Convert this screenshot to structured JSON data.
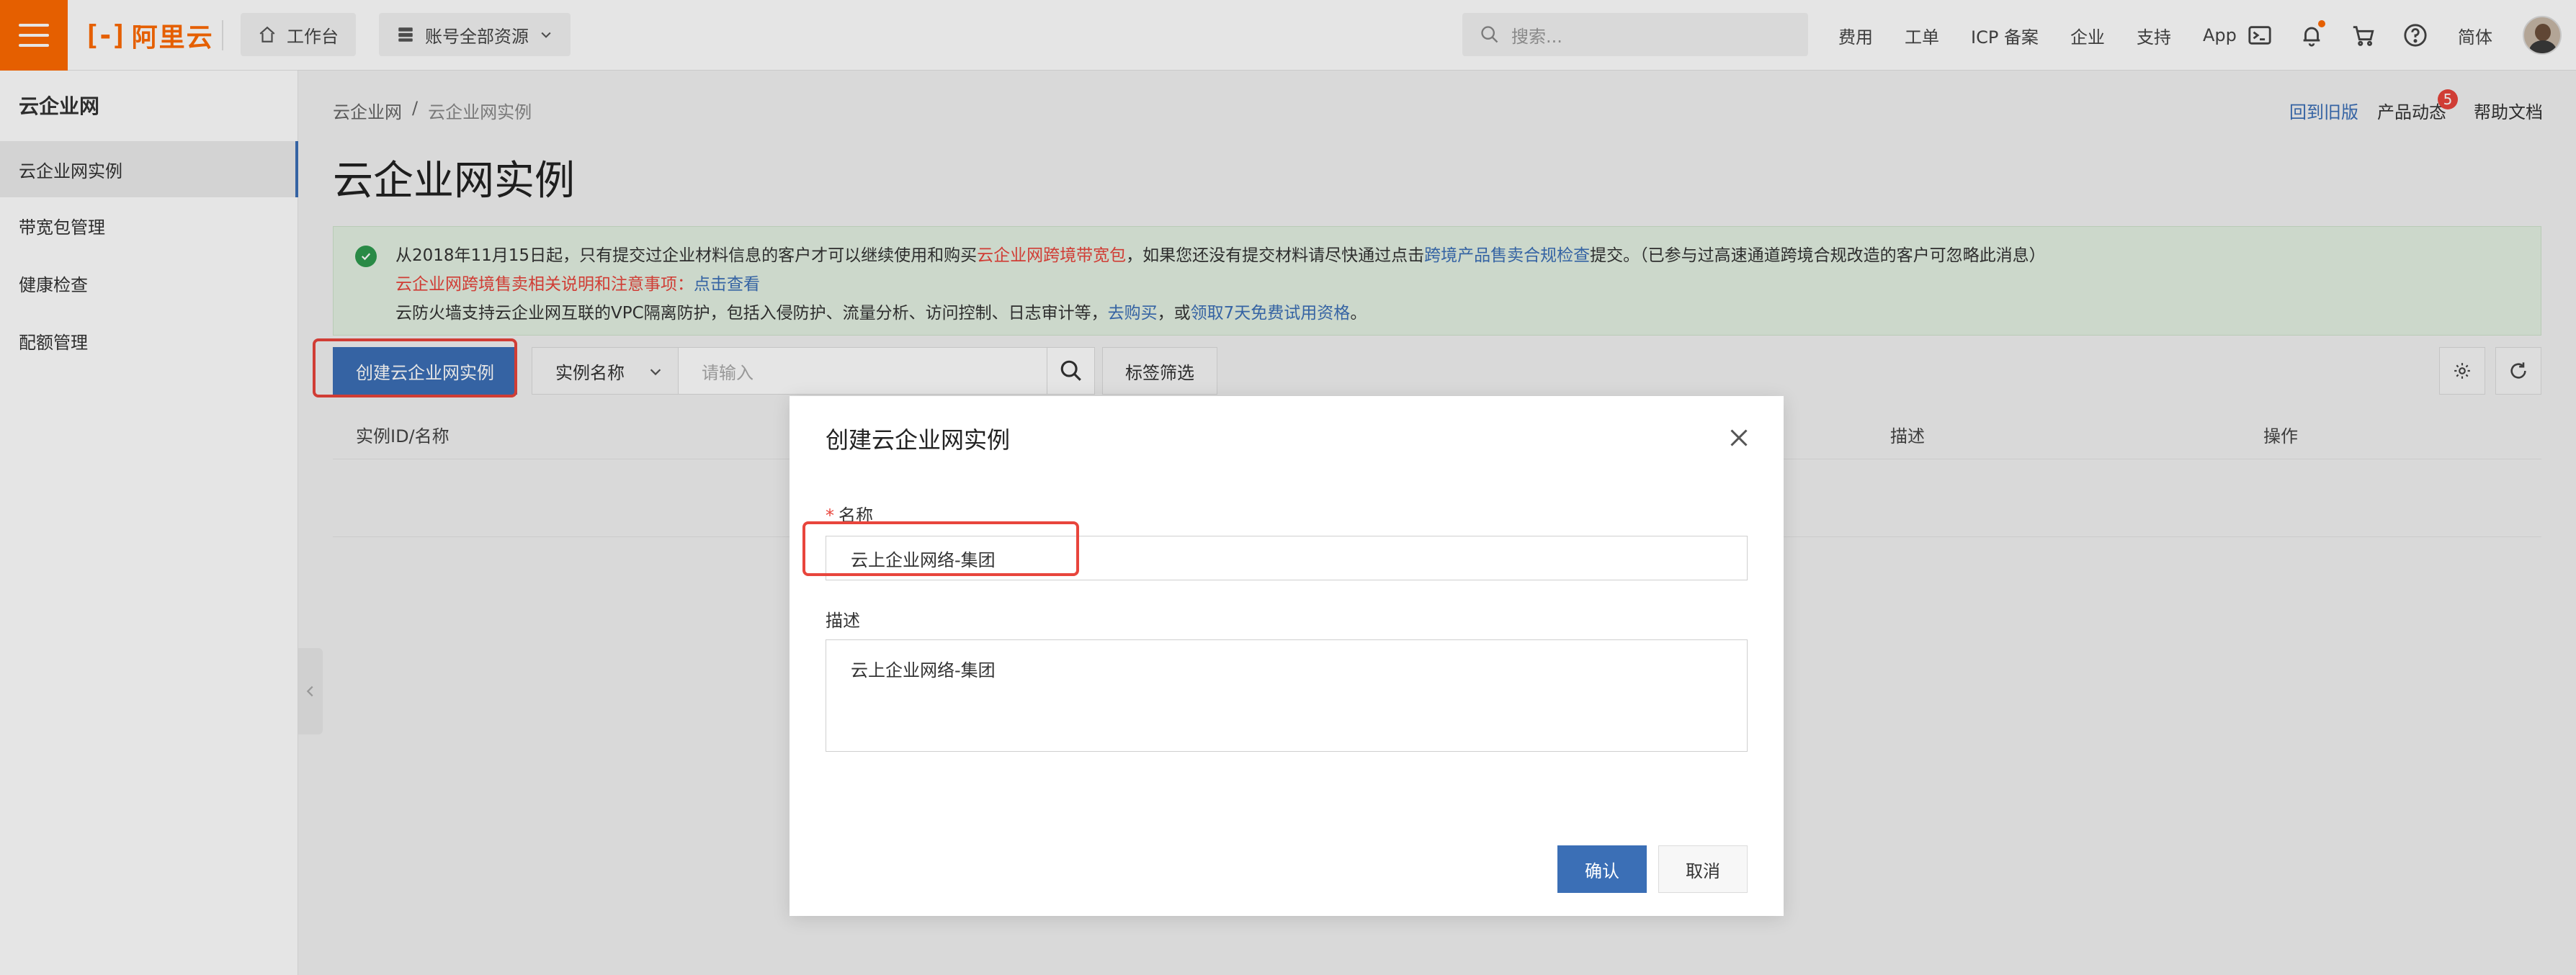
{
  "topbar": {
    "logo_text": "阿里云",
    "logo_mark": "[-]",
    "workbench_label": "工作台",
    "resource_label": "账号全部资源",
    "search_placeholder": "搜索...",
    "links": [
      "费用",
      "工单",
      "ICP 备案",
      "企业",
      "支持",
      "App"
    ],
    "icons": [
      "terminal-icon",
      "bell-icon",
      "cart-icon",
      "help-icon"
    ],
    "language": "简体"
  },
  "sidebar": {
    "title": "云企业网",
    "items": [
      {
        "label": "云企业网实例",
        "active": true
      },
      {
        "label": "带宽包管理",
        "active": false
      },
      {
        "label": "健康检查",
        "active": false
      },
      {
        "label": "配额管理",
        "active": false
      }
    ]
  },
  "main": {
    "breadcrumb": [
      "云企业网",
      "/",
      "云企业网实例"
    ],
    "top_links": {
      "old_version": "回到旧版",
      "product_news": "产品动态",
      "product_news_badge": "5",
      "help_docs": "帮助文档"
    },
    "title": "云企业网实例",
    "notice": {
      "line1_a": "从2018年11月15日起，只有提交过企业材料信息的客户才可以继续使用和购买",
      "line1_red": "云企业网跨境带宽包",
      "line1_b": "，如果您还没有提交材料请尽快通过点击",
      "line1_link": "跨境产品售卖合规检查",
      "line1_c": "提交。（已参与过高速通道跨境合规改造的客户可忽略此消息）",
      "line2_red": "云企业网跨境售卖相关说明和注意事项",
      "line2_sep": "：",
      "line2_link": "点击查看",
      "line3_a": "云防火墙支持云企业网互联的VPC隔离防护，包括入侵防护、流量分析、访问控制、日志审计等，",
      "line3_link1": "去购买",
      "line3_b": "，或",
      "line3_link2": "领取7天免费试用资格",
      "line3_c": "。"
    },
    "toolbar": {
      "create_label": "创建云企业网实例",
      "filter_select": "实例名称",
      "filter_placeholder": "请输入",
      "tag_filter": "标签筛选"
    },
    "table": {
      "headers": [
        "实例ID/名称",
        "描述",
        "操作"
      ]
    }
  },
  "modal": {
    "title": "创建云企业网实例",
    "name_label": "名称",
    "name_required_mark": "*",
    "name_value": "云上企业网络-集团",
    "desc_label": "描述",
    "desc_value": "云上企业网络-集团",
    "confirm_label": "确认",
    "cancel_label": "取消"
  },
  "colors": {
    "brand": "#ff6a00",
    "primary": "#3b6fb6",
    "highlight": "#e8453c",
    "notice_bg": "#e4f1e2"
  }
}
